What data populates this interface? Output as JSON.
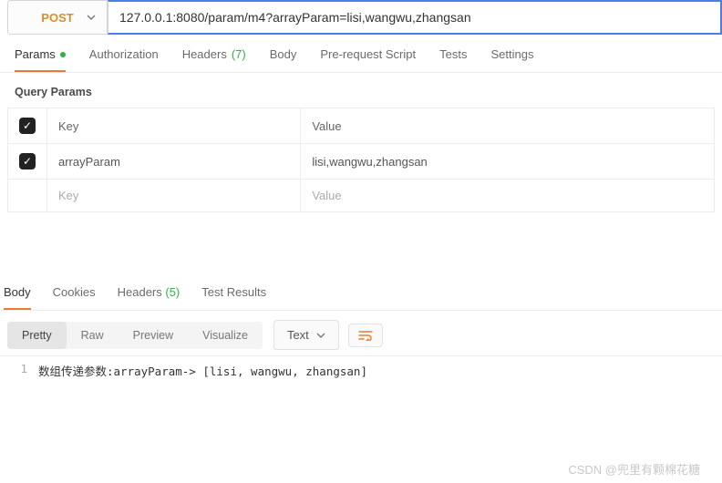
{
  "request": {
    "method": "POST",
    "url": "127.0.0.1:8080/param/m4?arrayParam=lisi,wangwu,zhangsan"
  },
  "requestTabs": {
    "params": "Params",
    "authorization": "Authorization",
    "headers": "Headers",
    "headersCount": "(7)",
    "body": "Body",
    "preRequest": "Pre-request Script",
    "tests": "Tests",
    "settings": "Settings"
  },
  "querySection": {
    "title": "Query Params",
    "headerKey": "Key",
    "headerValue": "Value",
    "rows": [
      {
        "key": "arrayParam",
        "value": "lisi,wangwu,zhangsan"
      }
    ],
    "placeholderKey": "Key",
    "placeholderValue": "Value"
  },
  "responseTabs": {
    "body": "Body",
    "cookies": "Cookies",
    "headers": "Headers",
    "headersCount": "(5)",
    "testResults": "Test Results"
  },
  "respToolbar": {
    "pretty": "Pretty",
    "raw": "Raw",
    "preview": "Preview",
    "visualize": "Visualize",
    "lang": "Text"
  },
  "responseBody": {
    "lineNum": "1",
    "text": "数组传递参数:arrayParam-> [lisi, wangwu, zhangsan]"
  },
  "watermark": "CSDN @兜里有颗棉花糖"
}
